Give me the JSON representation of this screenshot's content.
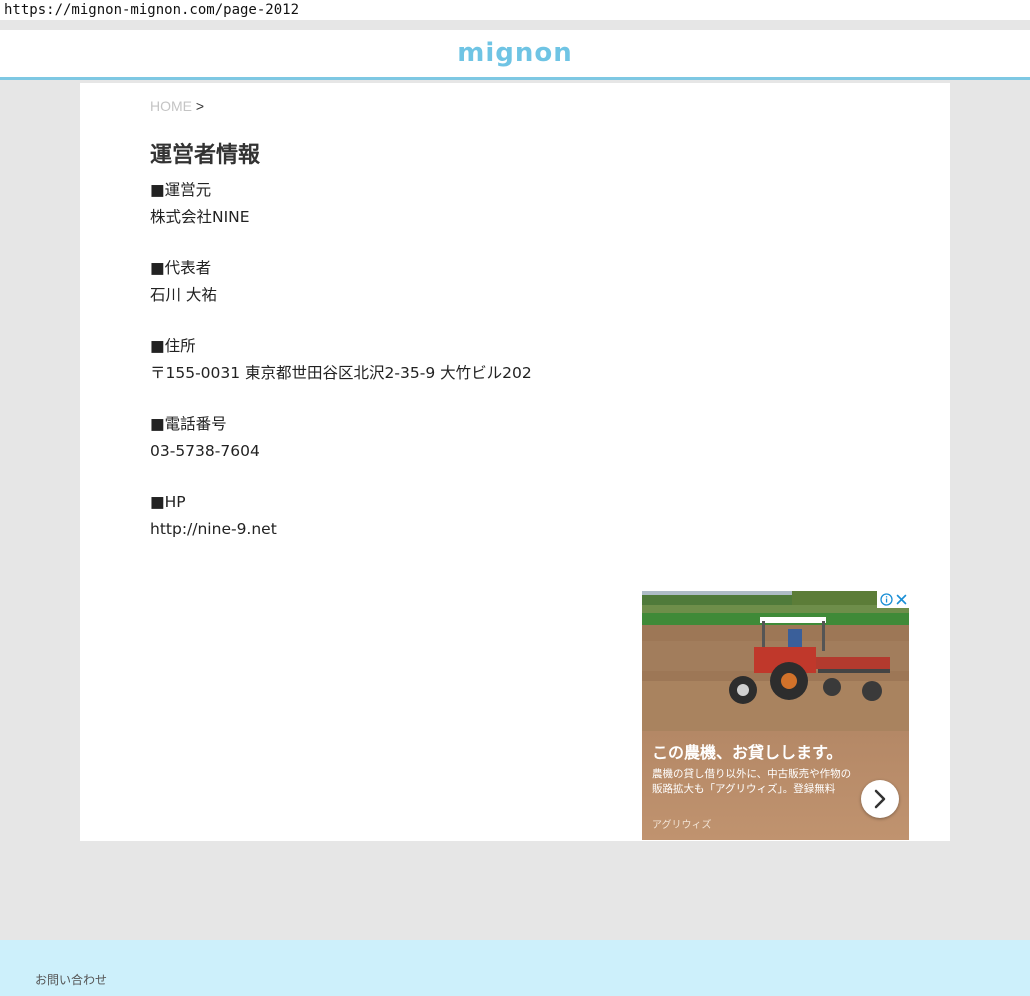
{
  "browser": {
    "url": "https://mignon-mignon.com/page-2012"
  },
  "header": {
    "logo_text": "mignon"
  },
  "breadcrumb": {
    "home": "HOME",
    "separator": ">"
  },
  "page": {
    "title": "運営者情報"
  },
  "info": [
    {
      "label": "■運営元",
      "value": "株式会社NINE"
    },
    {
      "label": "■代表者",
      "value": "石川 大祐"
    },
    {
      "label": "■住所",
      "value": "〒155-0031 東京都世田谷区北沢2-35-9 大竹ビル202"
    },
    {
      "label": "■電話番号",
      "value": "03-5738-7604"
    },
    {
      "label": "■HP",
      "value": "http://nine-9.net"
    }
  ],
  "ad": {
    "headline": "この農機、お貸しします。",
    "body": "農機の貸し借り以外に、中古販売や作物の販路拡大も「アグリウィズ」。登録無料",
    "advertiser": "アグリウィズ",
    "image_subject": "red tractor seeding a brown field"
  },
  "footer": {
    "contact_link": "お問い合わせ"
  },
  "colors": {
    "accent": "#7ec8e3",
    "logo": "#6fc4e4",
    "page_bg": "#e6e6e6",
    "footer_bg": "#cdf0fb",
    "breadcrumb_home": "#c4c4c4"
  }
}
